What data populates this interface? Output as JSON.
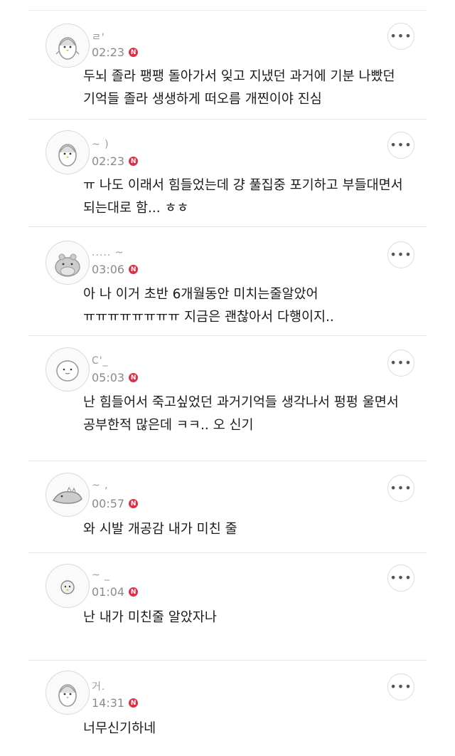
{
  "comments": [
    {
      "name": "ㄹ'",
      "time": "02:23",
      "badge": "N",
      "text": "두뇌 졸라 팽팽 돌아가서 잊고 지냈던 과거에 기분 나빴던 기억들 졸라 생생하게 떠오름 개찐이야 진심",
      "avatar": "penguin-avatar"
    },
    {
      "name": "~ )",
      "time": "02:23",
      "badge": "N",
      "text": "ㅠ 나도 이래서 힘들었는데 걍 풀집중 포기하고 부들대면서 되는대로 함... ㅎㅎ",
      "avatar": "penguin-avatar"
    },
    {
      "name": "..... ~",
      "time": "03:06",
      "badge": "N",
      "text": "아 나 이거 초반 6개월동안 미치는줄알았어 ㅠㅠㅠㅠㅠㅠㅠㅠ 지금은 괜찮아서 다행이지..",
      "avatar": "hippo-avatar"
    },
    {
      "name": "C'_",
      "time": "05:03",
      "badge": "N",
      "text": "난 힘들어서 죽고싶었던 과거기억들 생각나서 펑펑 울면서 공부한적 많은데 ㅋㅋ.. 오 신기",
      "avatar": "blob-avatar"
    },
    {
      "name": "~ ,",
      "time": "00:57",
      "badge": "N",
      "text": "와 시발 개공감 내가 미친 줄",
      "avatar": "dino-avatar"
    },
    {
      "name": "~ _",
      "time": "01:04",
      "badge": "N",
      "text": "난 내가 미친줄 알았자나",
      "avatar": "chick-avatar"
    },
    {
      "name": "거.",
      "time": "14:31",
      "badge": "N",
      "text": "너무신기하네",
      "avatar": "penguin-avatar"
    }
  ],
  "more_label": "•••"
}
